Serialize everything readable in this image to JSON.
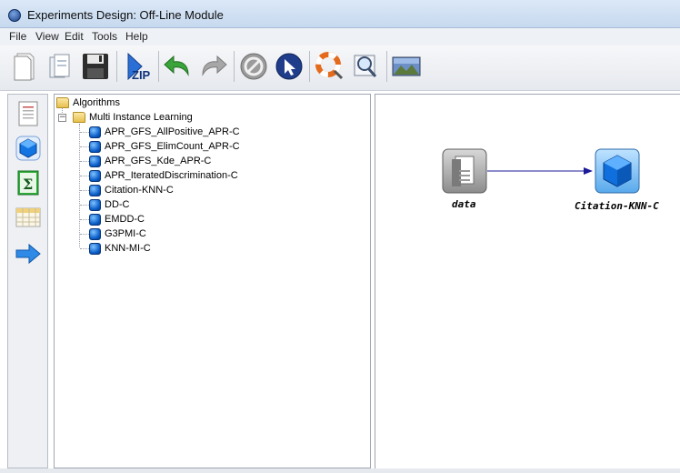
{
  "window": {
    "title": "Experiments Design: Off-Line Module"
  },
  "menu": [
    "File",
    "View",
    "Edit",
    "Tools",
    "Help"
  ],
  "toolbar": {
    "zip_label": "ZIP"
  },
  "tree": {
    "root": "Algorithms",
    "group": "Multi Instance Learning",
    "items": [
      "APR_GFS_AllPositive_APR-C",
      "APR_GFS_ElimCount_APR-C",
      "APR_GFS_Kde_APR-C",
      "APR_IteratedDiscrimination-C",
      "Citation-KNN-C",
      "DD-C",
      "EMDD-C",
      "G3PMI-C",
      "KNN-MI-C"
    ]
  },
  "canvas": {
    "data_node_label": "data",
    "algorithm_node_label": "Citation-KNN-C"
  },
  "colors": {
    "accent_blue": "#0b5ec9",
    "arrow_color": "#1a1a9a"
  }
}
